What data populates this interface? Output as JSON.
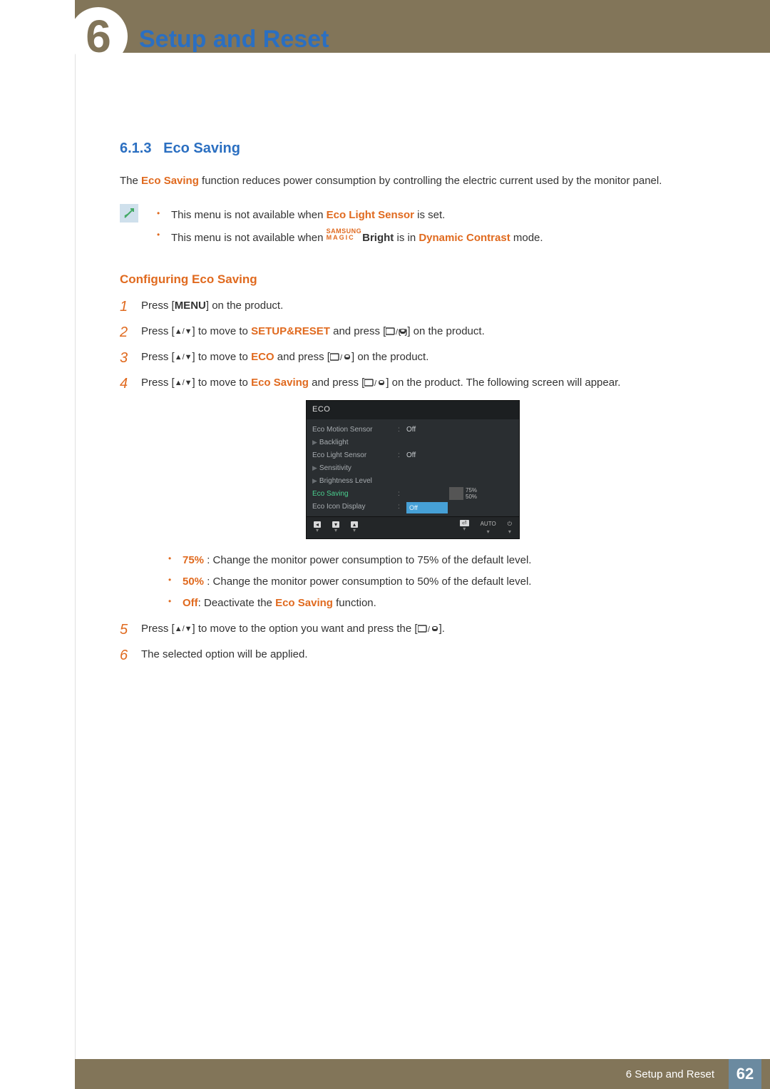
{
  "header": {
    "chapter_number": "6",
    "chapter_title": "Setup and Reset"
  },
  "section": {
    "number": "6.1.3",
    "title": "Eco Saving"
  },
  "intro": {
    "pre": "The ",
    "term": "Eco Saving",
    "post": " function reduces power consumption by controlling the electric current used by the monitor panel."
  },
  "notes": [
    {
      "pre": "This menu is not available when ",
      "term": "Eco Light Sensor",
      "post": " is set."
    },
    {
      "pre": "This menu is not available when ",
      "logo_top": "SAMSUNG",
      "logo_bot": "MAGIC",
      "term2": "Bright",
      "mid": " is in ",
      "term3": "Dynamic Contrast",
      "post": " mode."
    }
  ],
  "subhead": "Configuring Eco Saving",
  "steps": {
    "s1": {
      "n": "1",
      "t_pre": "Press [",
      "menu": "MENU",
      "t_post": "] on the product."
    },
    "s2": {
      "n": "2",
      "t_pre": "Press [",
      "arrows": "▲/▼",
      "t_mid": "] to move to ",
      "term": "SETUP&RESET",
      "t_mid2": " and press [",
      "t_post": "] on the product."
    },
    "s3": {
      "n": "3",
      "t_pre": "Press [",
      "arrows": "▲/▼",
      "t_mid": "] to move to ",
      "term": "ECO",
      "t_mid2": " and press [",
      "t_post": "] on the product."
    },
    "s4": {
      "n": "4",
      "t_pre": "Press [",
      "arrows": "▲/▼",
      "t_mid": "] to move to ",
      "term": "Eco Saving",
      "t_mid2": " and press [",
      "t_post": "] on the product. The following screen will appear."
    },
    "s5": {
      "n": "5",
      "t_pre": "Press [",
      "arrows": "▲/▼",
      "t_mid": "] to move to the option you want and press the [",
      "t_post": "]."
    },
    "s6": {
      "n": "6",
      "t": "The selected option will be applied."
    }
  },
  "osd": {
    "title": "ECO",
    "rows": [
      {
        "label": "Eco Motion Sensor",
        "value": "Off",
        "indent": false
      },
      {
        "label": "Backlight",
        "value": "",
        "indent": true
      },
      {
        "label": "Eco Light Sensor",
        "value": "Off",
        "indent": false
      },
      {
        "label": "Sensitivity",
        "value": "",
        "indent": true
      },
      {
        "label": "Brightness Level",
        "value": "",
        "indent": true
      }
    ],
    "active": {
      "label": "Eco Saving",
      "option1": "75%",
      "option2": "50%"
    },
    "last": {
      "label": "Eco Icon Display",
      "value": "Off",
      "select": true
    },
    "footer": {
      "auto": "AUTO"
    }
  },
  "options": [
    {
      "term": "75%",
      "text": " : Change the monitor power consumption to 75% of the default level."
    },
    {
      "term": "50%",
      "text": " : Change the monitor power consumption to 50% of the default level."
    },
    {
      "term": "Off",
      "mid": ": Deactivate the ",
      "term2": "Eco Saving",
      "post": " function."
    }
  ],
  "footer": {
    "chapter_label": "6 Setup and Reset",
    "page": "62"
  }
}
